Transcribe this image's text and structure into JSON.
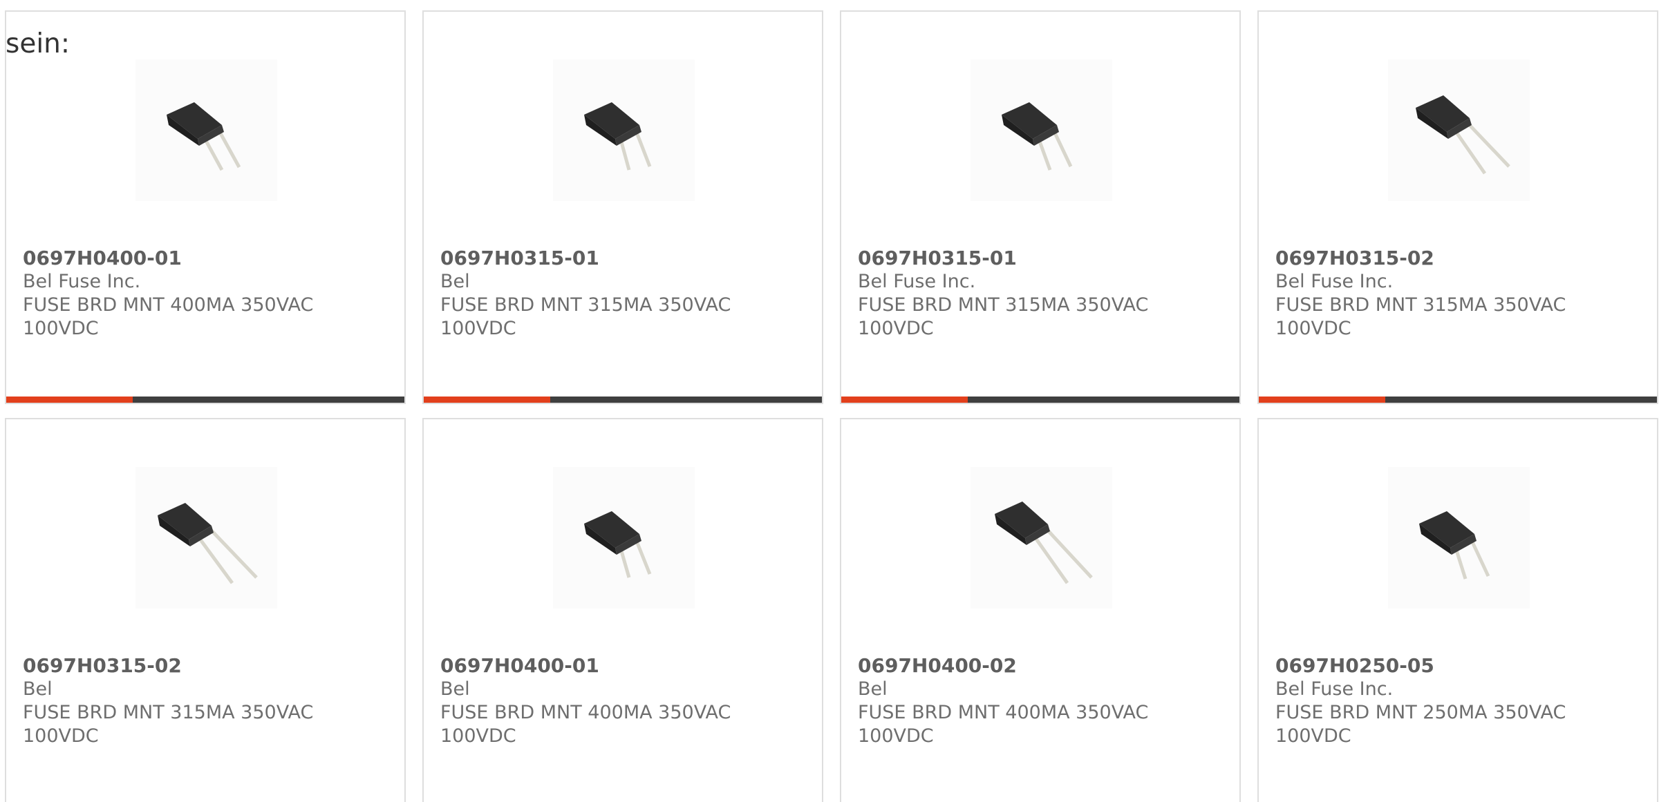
{
  "intro_text": "sein:",
  "colors": {
    "accent": "#e2401c",
    "bar_dark": "#3f3f3f",
    "border": "#dedede",
    "text": "#6e6e6e"
  },
  "products": [
    {
      "part_number": "0697H0400-01",
      "manufacturer": "Bel Fuse Inc.",
      "description": "FUSE BRD MNT 400MA 350VAC 100VDC",
      "image": "fuse-component-icon"
    },
    {
      "part_number": "0697H0315-01",
      "manufacturer": "Bel",
      "description": "FUSE BRD MNT 315MA 350VAC 100VDC",
      "image": "fuse-component-icon"
    },
    {
      "part_number": "0697H0315-01",
      "manufacturer": "Bel Fuse Inc.",
      "description": "FUSE BRD MNT 315MA 350VAC 100VDC",
      "image": "fuse-component-icon"
    },
    {
      "part_number": "0697H0315-02",
      "manufacturer": "Bel Fuse Inc.",
      "description": "FUSE BRD MNT 315MA 350VAC 100VDC",
      "image": "fuse-component-icon"
    },
    {
      "part_number": "0697H0315-02",
      "manufacturer": "Bel",
      "description": "FUSE BRD MNT 315MA 350VAC 100VDC",
      "image": "fuse-component-icon"
    },
    {
      "part_number": "0697H0400-01",
      "manufacturer": "Bel",
      "description": "FUSE BRD MNT 400MA 350VAC 100VDC",
      "image": "fuse-component-icon"
    },
    {
      "part_number": "0697H0400-02",
      "manufacturer": "Bel",
      "description": "FUSE BRD MNT 400MA 350VAC 100VDC",
      "image": "fuse-component-icon"
    },
    {
      "part_number": "0697H0250-05",
      "manufacturer": "Bel Fuse Inc.",
      "description": "FUSE BRD MNT 250MA 350VAC 100VDC",
      "image": "fuse-component-icon"
    }
  ]
}
